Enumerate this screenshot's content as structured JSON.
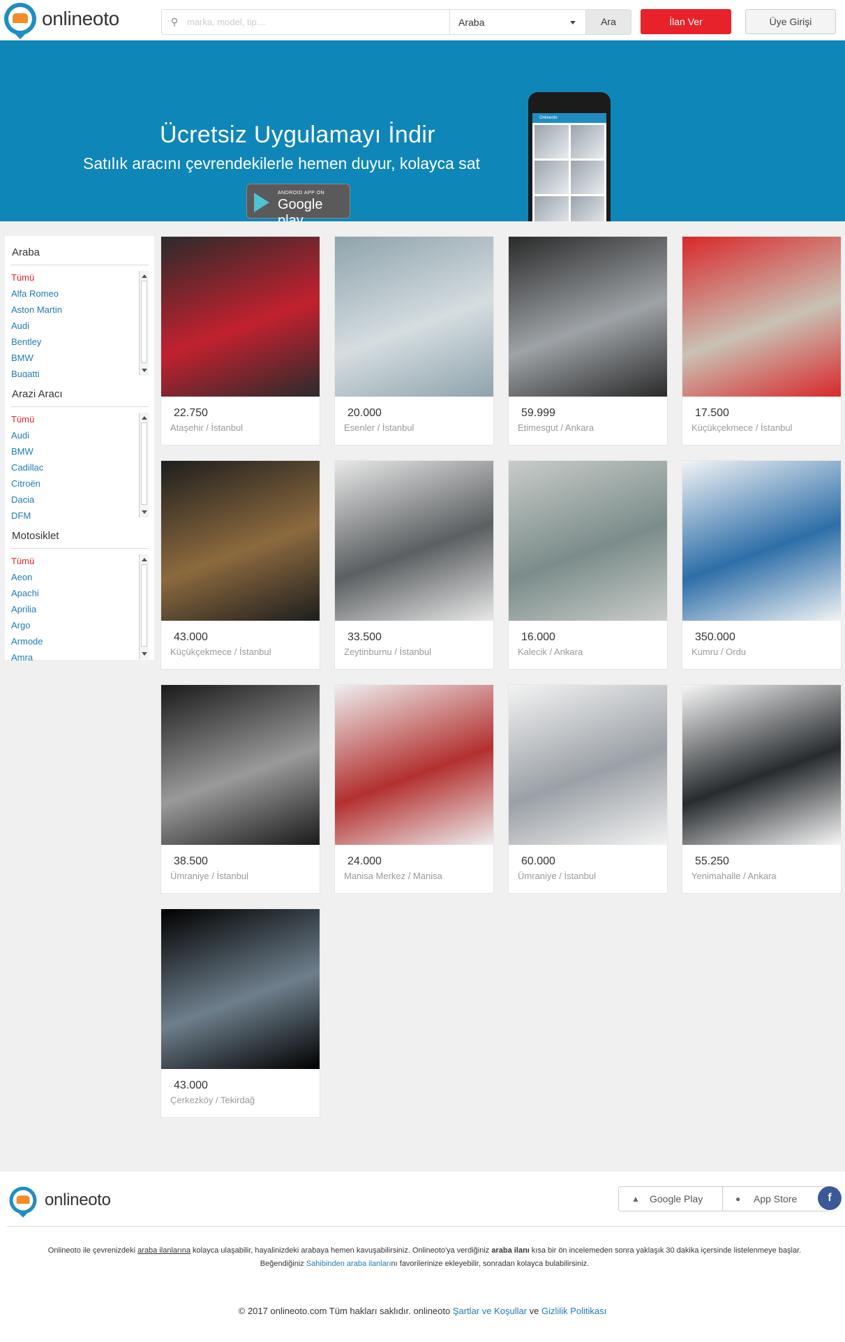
{
  "header": {
    "brand": "onlineoto",
    "search_placeholder": "marka, model, tip....",
    "category_selected": "Araba",
    "search_button": "Ara",
    "post_button": "İlan Ver",
    "login_button": "Üye Girişi"
  },
  "banner": {
    "title": "Ücretsiz Uygulamayı İndir",
    "subtitle": "Satılık aracını çevrendekilerle hemen duyur, kolayca sat",
    "store_small": "ANDROID APP ON",
    "store_big": "Google play",
    "phone_app_title": "Onlineoto"
  },
  "sidebar": {
    "sections": [
      {
        "title": "Araba",
        "items": [
          "Tümü",
          "Alfa Romeo",
          "Aston Martin",
          "Audi",
          "Bentley",
          "BMW",
          "Bugatti"
        ]
      },
      {
        "title": "Arazi Aracı",
        "items": [
          "Tümü",
          "Audi",
          "BMW",
          "Cadillac",
          "Citroën",
          "Dacia",
          "DFM"
        ]
      },
      {
        "title": "Motosiklet",
        "items": [
          "Tümü",
          "Aeon",
          "Apachi",
          "Aprilia",
          "Argo",
          "Armode",
          "Amra"
        ]
      }
    ]
  },
  "listings": [
    {
      "price": "22.750",
      "location": "Ataşehir / İstanbul",
      "c1": "#2b2b2b",
      "c2": "#c2212f"
    },
    {
      "price": "20.000",
      "location": "Esenler / İstanbul",
      "c1": "#8fa3ac",
      "c2": "#d5dde0"
    },
    {
      "price": "59.999",
      "location": "Etimesgut / Ankara",
      "c1": "#2a2a2a",
      "c2": "#9ea3a7"
    },
    {
      "price": "17.500",
      "location": "Küçükçekmece / İstanbul",
      "c1": "#d8282b",
      "c2": "#c9c2b4"
    },
    {
      "price": "43.000",
      "location": "Küçükçekmece / İstanbul",
      "c1": "#1e1e1e",
      "c2": "#8c6a3e"
    },
    {
      "price": "33.500",
      "location": "Zeytinburnu / İstanbul",
      "c1": "#e8e8e8",
      "c2": "#5b5f61"
    },
    {
      "price": "16.000",
      "location": "Kalecik / Ankara",
      "c1": "#c8ccc9",
      "c2": "#7b8c8a"
    },
    {
      "price": "350.000",
      "location": "Kumru / Ordu",
      "c1": "#f1f3f5",
      "c2": "#2d6ea8"
    },
    {
      "price": "38.500",
      "location": "Ümraniye / İstanbul",
      "c1": "#1a1a1a",
      "c2": "#9a9a9a"
    },
    {
      "price": "24.000",
      "location": "Manisa Merkez / Manisa",
      "c1": "#eeeeee",
      "c2": "#b2302f"
    },
    {
      "price": "60.000",
      "location": "Ümraniye / İstanbul",
      "c1": "#f3f3f3",
      "c2": "#9aa0a6"
    },
    {
      "price": "55.250",
      "location": "Yenimahalle / Ankara",
      "c1": "#f7f7f7",
      "c2": "#272b2e"
    },
    {
      "price": "43.000",
      "location": "Çerkezköy / Tekirdağ",
      "c1": "#000000",
      "c2": "#6e7f8c"
    }
  ],
  "footer": {
    "brand": "onlineoto",
    "google_play": "Google Play",
    "app_store": "App Store",
    "facebook_letter": "f",
    "about_1a": "Onlineoto ile çevrenizdeki ",
    "about_1b": "araba ilanlarına",
    "about_1c": " kolayca ulaşabilir, hayalinizdeki arabaya hemen kavuşabilirsiniz. Onlineoto'ya verdiğiniz ",
    "about_1d": "araba ilanı",
    "about_1e": " kısa bir ön incelemeden sonra yaklaşık 30 dakika içersinde listelenmeye başlar.",
    "about_2a": "Beğendiğiniz ",
    "about_2b": "Sahibinden araba ilanları",
    "about_2c": "nı favorilerinize ekleyebilir, sonradan kolayca bulabilirsiniz.",
    "copy_a": "© 2017 onlineoto.com Tüm hakları saklıdır. onlineoto ",
    "copy_b": "Şartlar ve Koşullar",
    "copy_c": " ve ",
    "copy_d": "Gizlilik Politikası"
  }
}
